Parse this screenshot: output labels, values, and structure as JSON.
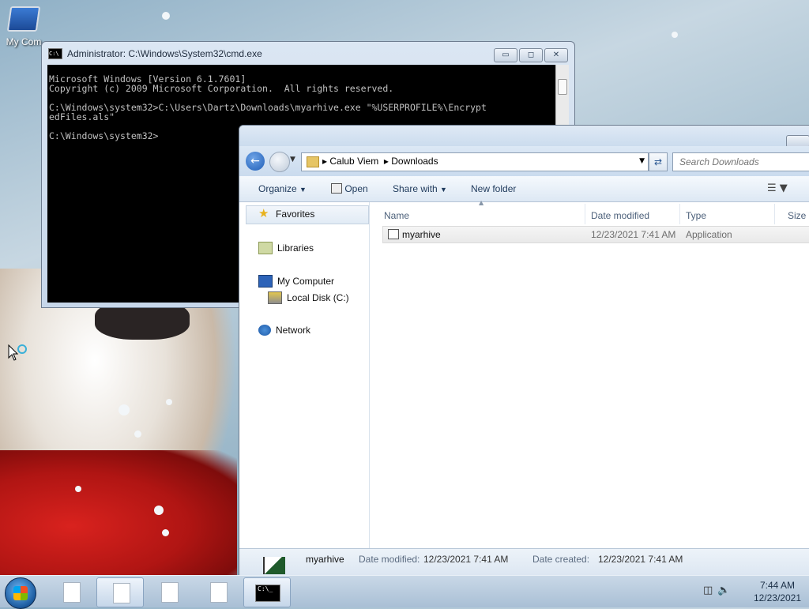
{
  "desktop": {
    "icon_label": "My Com"
  },
  "cmd_window": {
    "title": "Administrator: C:\\Windows\\System32\\cmd.exe",
    "lines": [
      "Microsoft Windows [Version 6.1.7601]",
      "Copyright (c) 2009 Microsoft Corporation.  All rights reserved.",
      "",
      "C:\\Windows\\system32>C:\\Users\\Dartz\\Downloads\\myarhive.exe \"%USERPROFILE%\\Encrypt",
      "edFiles.als\"",
      "",
      "C:\\Windows\\system32>"
    ],
    "icon_text": "C:\\",
    "buttons": {
      "minimize": "▭",
      "maximize": "◻",
      "close": "✕"
    }
  },
  "explorer": {
    "breadcrumb": [
      "Calub Viem",
      "Downloads"
    ],
    "search_placeholder": "Search Downloads",
    "toolbar": {
      "organize": "Organize",
      "open": "Open",
      "share_with": "Share with",
      "new_folder": "New folder"
    },
    "nav": {
      "favorites": "Favorites",
      "libraries": "Libraries",
      "my_computer": "My Computer",
      "local_disk": "Local Disk (C:)",
      "network": "Network"
    },
    "columns": {
      "name": "Name",
      "date_modified": "Date modified",
      "type": "Type",
      "size": "Size"
    },
    "files": [
      {
        "name": "myarhive",
        "date_modified": "12/23/2021 7:41 AM",
        "type": "Application"
      }
    ],
    "details": {
      "name": "myarhive",
      "date_modified_label": "Date modified:",
      "date_modified": "12/23/2021 7:41 AM",
      "date_created_label": "Date created:",
      "date_created": "12/23/2021 7:41 AM"
    }
  },
  "taskbar": {
    "time": "7:44 AM",
    "date": "12/23/2021",
    "cmd_icon_text": "C:\\_"
  }
}
